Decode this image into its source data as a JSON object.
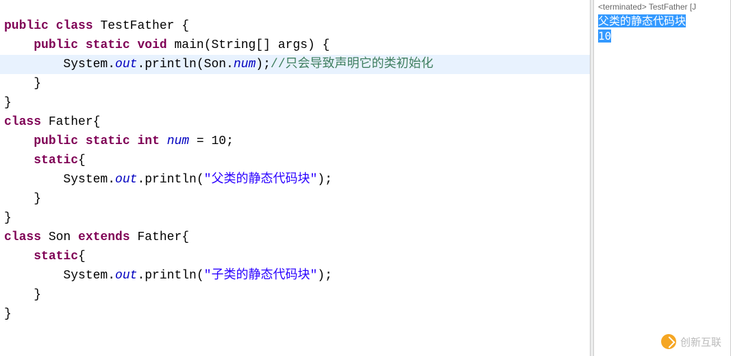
{
  "code": {
    "l1_kw1": "public",
    "l1_kw2": "class",
    "l1_name": " TestFather {",
    "l2_kw1": "public",
    "l2_kw2": "static",
    "l2_kw3": "void",
    "l2_name": " main(String[] args) {",
    "l3_pre": "        System.",
    "l3_out": "out",
    "l3_mid": ".println(Son.",
    "l3_num": "num",
    "l3_end": ");",
    "l3_cmt": "//只会导致声明它的类初始化",
    "l4": "    }",
    "l5": "}",
    "l6_kw": "class",
    "l6_name": " Father{",
    "l7_kw1": "public",
    "l7_kw2": "static",
    "l7_kw3": "int",
    "l7_num": "num",
    "l7_end": " = 10;",
    "l8_kw": "static",
    "l8_brace": "{",
    "l9_pre": "        System.",
    "l9_out": "out",
    "l9_mid": ".println(",
    "l9_str": "\"父类的静态代码块\"",
    "l9_end": ");",
    "l10": "    }",
    "l11": "}",
    "l12_kw1": "class",
    "l12_name": " Son ",
    "l12_kw2": "extends",
    "l12_name2": " Father{",
    "l13_kw": "static",
    "l13_brace": "{",
    "l14_pre": "        System.",
    "l14_out": "out",
    "l14_mid": ".println(",
    "l14_str": "\"子类的静态代码块\"",
    "l14_end": ");",
    "l15": "    }",
    "l16": "}"
  },
  "console": {
    "header": "<terminated> TestFather [J",
    "out1": "父类的静态代码块",
    "out2": "10"
  },
  "watermark": "创新互联"
}
